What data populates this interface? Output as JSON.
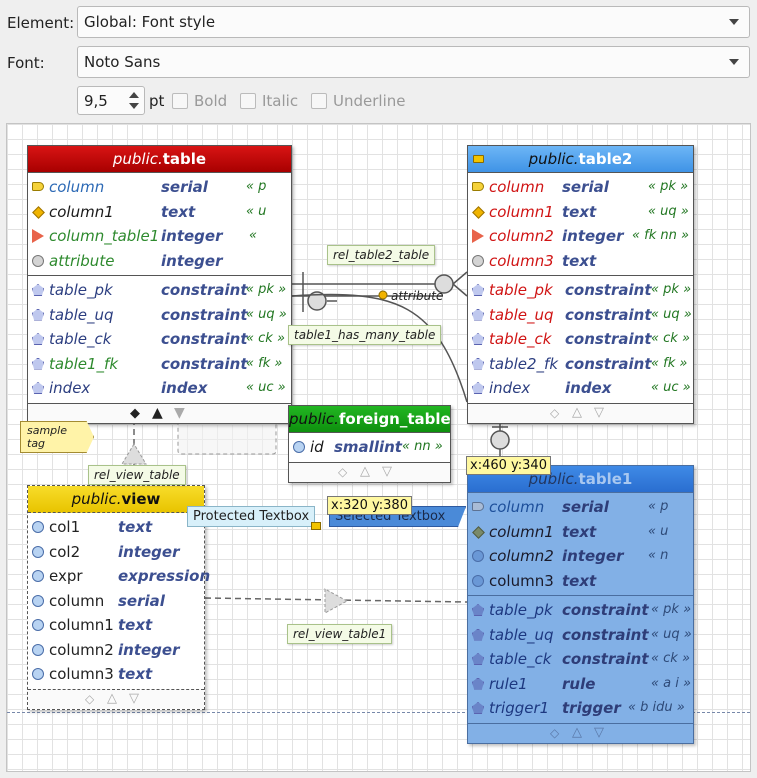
{
  "form": {
    "element_label": "Element:",
    "element_value": "Global: Font style",
    "font_label": "Font:",
    "font_value": "Noto Sans",
    "size_value": "9,5",
    "size_unit": "pt",
    "bold_label": "Bold",
    "italic_label": "Italic",
    "underline_label": "Underline"
  },
  "colors": {
    "table_header": "#c40606",
    "table2_header": "#55a6ee",
    "foreign_header": "#1aa21a",
    "view_header": "#f2d21c",
    "table1_header": "#3a7fd8",
    "table1_body": "#82b0e6"
  },
  "tables": {
    "table": {
      "schema": "public.",
      "name": "table",
      "columns": [
        {
          "icon": "key-icon",
          "name": "column",
          "type": "serial",
          "cons": "« p"
        },
        {
          "icon": "diamond-icon",
          "name": "column1",
          "type": "text",
          "cons": "« u"
        },
        {
          "icon": "arrow-icon",
          "name": "column_table1",
          "type": "integer",
          "cons": "« "
        },
        {
          "icon": "circle-icon",
          "name": "attribute",
          "type": "integer",
          "cons": ""
        }
      ],
      "constraints": [
        {
          "name": "table_pk",
          "type": "constraint",
          "cons": "« pk »"
        },
        {
          "name": "table_uq",
          "type": "constraint",
          "cons": "« uq »"
        },
        {
          "name": "table_ck",
          "type": "constraint",
          "cons": "« ck »"
        },
        {
          "name": "table1_fk",
          "type": "constraint",
          "cons": "« fk »"
        },
        {
          "name": "index",
          "type": "index",
          "cons": "« uc »"
        }
      ]
    },
    "table2": {
      "schema": "public.",
      "name": "table2",
      "columns": [
        {
          "name": "column",
          "type": "serial",
          "cons": "« pk »"
        },
        {
          "name": "column1",
          "type": "text",
          "cons": "« uq »"
        },
        {
          "name": "column2",
          "type": "integer",
          "cons": "« fk nn »"
        },
        {
          "name": "column3",
          "type": "text",
          "cons": ""
        }
      ],
      "constraints": [
        {
          "name": "table_pk",
          "type": "constraint",
          "cons": "« pk »"
        },
        {
          "name": "table_uq",
          "type": "constraint",
          "cons": "« uq »"
        },
        {
          "name": "table_ck",
          "type": "constraint",
          "cons": "« ck »"
        },
        {
          "name": "table2_fk",
          "type": "constraint",
          "cons": "« fk »"
        },
        {
          "name": "index",
          "type": "index",
          "cons": "« uc »"
        }
      ]
    },
    "foreign_table": {
      "schema": "public.",
      "name": "foreign_table",
      "columns": [
        {
          "name": "id",
          "type": "smallint",
          "cons": "« nn »"
        }
      ]
    },
    "view": {
      "schema": "public.",
      "name": "view",
      "columns": [
        {
          "name": "col1",
          "type": "text"
        },
        {
          "name": "col2",
          "type": "integer"
        },
        {
          "name": "expr",
          "type": "expression"
        },
        {
          "name": "column",
          "type": "serial"
        },
        {
          "name": "column1",
          "type": "text"
        },
        {
          "name": "column2",
          "type": "integer"
        },
        {
          "name": "column3",
          "type": "text"
        }
      ]
    },
    "table1": {
      "schema": "public.",
      "name": "table1",
      "columns": [
        {
          "name": "column",
          "type": "serial",
          "cons": "« p"
        },
        {
          "name": "column1",
          "type": "text",
          "cons": "« u"
        },
        {
          "name": "column2",
          "type": "integer",
          "cons": "« n"
        },
        {
          "name": "column3",
          "type": "text",
          "cons": ""
        }
      ],
      "constraints": [
        {
          "name": "table_pk",
          "type": "constraint",
          "cons": "« pk »"
        },
        {
          "name": "table_uq",
          "type": "constraint",
          "cons": "« uq »"
        },
        {
          "name": "table_ck",
          "type": "constraint",
          "cons": "« ck »"
        },
        {
          "name": "rule1",
          "type": "rule",
          "cons": "« a i »"
        },
        {
          "name": "trigger1",
          "type": "trigger",
          "cons": "« b idu »"
        }
      ]
    }
  },
  "labels": {
    "rel_table2_table": "rel_table2_table",
    "table1_has_many_table": "table1_has_many_table",
    "rel_view_table": "rel_view_table",
    "rel_view_table1": "rel_view_table1",
    "attribute": "attribute",
    "sample_tag": "sample tag",
    "tip1": "x:460 y:340",
    "tip2": "x:320 y:380",
    "protected_textbox": "Protected Textbox",
    "selected_textbox": "Selected Textbox"
  }
}
